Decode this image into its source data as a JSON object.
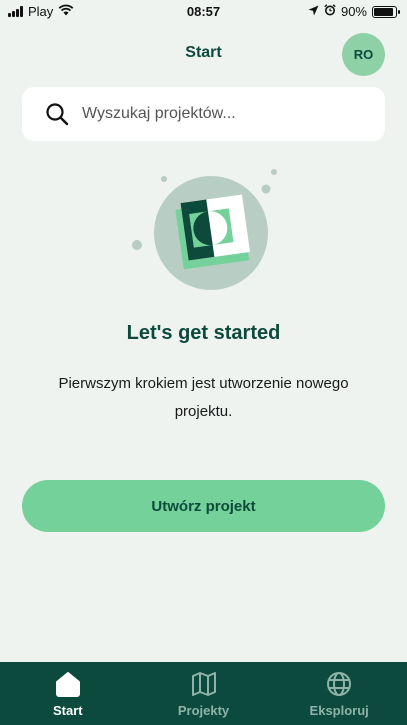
{
  "status_bar": {
    "carrier": "Play",
    "time": "08:57",
    "battery": "90%",
    "battery_level": 0.9
  },
  "header": {
    "title": "Start",
    "avatar_initials": "RO"
  },
  "search": {
    "placeholder": "Wyszukaj projektów...",
    "icon": "search-icon"
  },
  "empty_state": {
    "title": "Let's get started",
    "description": "Pierwszym krokiem jest utworzenie nowego projektu.",
    "button_label": "Utwórz projekt"
  },
  "tab_bar": {
    "items": [
      {
        "label": "Start",
        "icon": "home-icon",
        "active": true
      },
      {
        "label": "Projekty",
        "icon": "map-icon",
        "active": false
      },
      {
        "label": "Eksploruj",
        "icon": "globe-icon",
        "active": false
      }
    ]
  },
  "colors": {
    "background": "#eef3f0",
    "primary_dark": "#0b4a3d",
    "accent_green": "#74d19a",
    "avatar_bg": "#8fd1a6"
  }
}
